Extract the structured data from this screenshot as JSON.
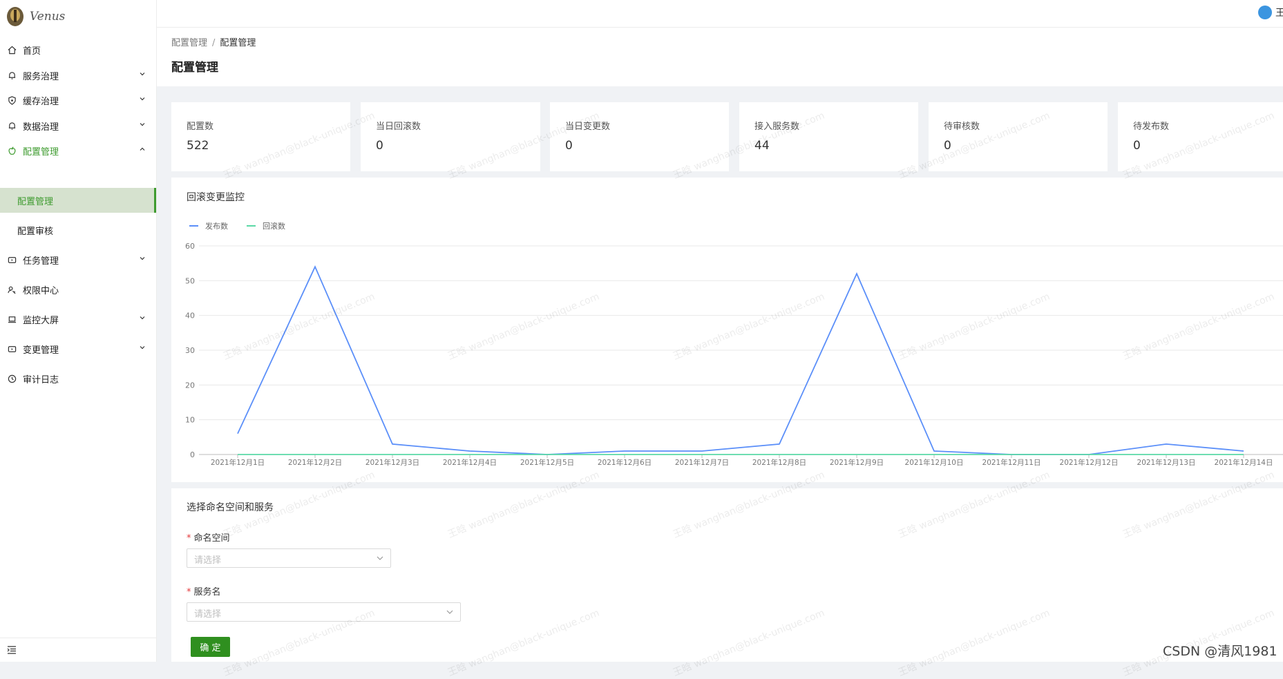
{
  "app": {
    "logo_text": "Venus"
  },
  "sidebar": {
    "items": [
      {
        "label": "首页",
        "icon": "home-icon"
      },
      {
        "label": "服务治理",
        "icon": "bell-icon"
      },
      {
        "label": "缓存治理",
        "icon": "shield-icon"
      },
      {
        "label": "数据治理",
        "icon": "bell-icon"
      },
      {
        "label": "配置管理",
        "icon": "apple-icon",
        "open": true
      },
      {
        "label": "任务管理",
        "icon": "play-box-icon"
      },
      {
        "label": "权限中心",
        "icon": "user-key-icon"
      },
      {
        "label": "监控大屏",
        "icon": "laptop-icon"
      },
      {
        "label": "变更管理",
        "icon": "play-box-icon"
      },
      {
        "label": "审计日志",
        "icon": "clock-icon"
      }
    ],
    "sub_items": [
      {
        "label": "配置管理",
        "active": true
      },
      {
        "label": "配置审核",
        "active": false
      }
    ],
    "collapse_icon": "menu-fold-icon"
  },
  "header": {
    "user_initial": "王"
  },
  "breadcrumb": {
    "parent": "配置管理",
    "separator": "/",
    "current": "配置管理"
  },
  "page": {
    "title": "配置管理"
  },
  "stats": [
    {
      "label": "配置数",
      "value": "522"
    },
    {
      "label": "当日回滚数",
      "value": "0"
    },
    {
      "label": "当日变更数",
      "value": "0"
    },
    {
      "label": "接入服务数",
      "value": "44"
    },
    {
      "label": "待审核数",
      "value": "0"
    },
    {
      "label": "待发布数",
      "value": "0"
    }
  ],
  "chart_panel": {
    "title": "回滚变更监控"
  },
  "chart_data": {
    "type": "line",
    "title": "回滚变更监控",
    "categories": [
      "2021年12月1日",
      "2021年12月2日",
      "2021年12月3日",
      "2021年12月4日",
      "2021年12月5日",
      "2021年12月6日",
      "2021年12月7日",
      "2021年12月8日",
      "2021年12月9日",
      "2021年12月10日",
      "2021年12月11日",
      "2021年12月12日",
      "2021年12月13日",
      "2021年12月14日"
    ],
    "series": [
      {
        "name": "发布数",
        "color": "#5b8ff9",
        "values": [
          6,
          54,
          3,
          1,
          0,
          1,
          1,
          3,
          52,
          1,
          0,
          0,
          3,
          1
        ]
      },
      {
        "name": "回滚数",
        "color": "#5ad8a6",
        "values": [
          0,
          0,
          0,
          0,
          0,
          0,
          0,
          0,
          0,
          0,
          0,
          0,
          0,
          0
        ]
      }
    ],
    "yticks": [
      0,
      10,
      20,
      30,
      40,
      50,
      60
    ],
    "ylim": [
      0,
      60
    ],
    "grid": true,
    "legend": "top-left"
  },
  "form": {
    "title": "选择命名空间和服务",
    "namespace": {
      "label": "命名空间",
      "required_mark": "*",
      "placeholder": "请选择"
    },
    "service": {
      "label": "服务名",
      "required_mark": "*",
      "placeholder": "请选择"
    },
    "confirm_label": "确 定"
  },
  "watermark": {
    "text": "王晗 wanghan@black-unique.com"
  },
  "footer_credit": "CSDN @清风1981"
}
